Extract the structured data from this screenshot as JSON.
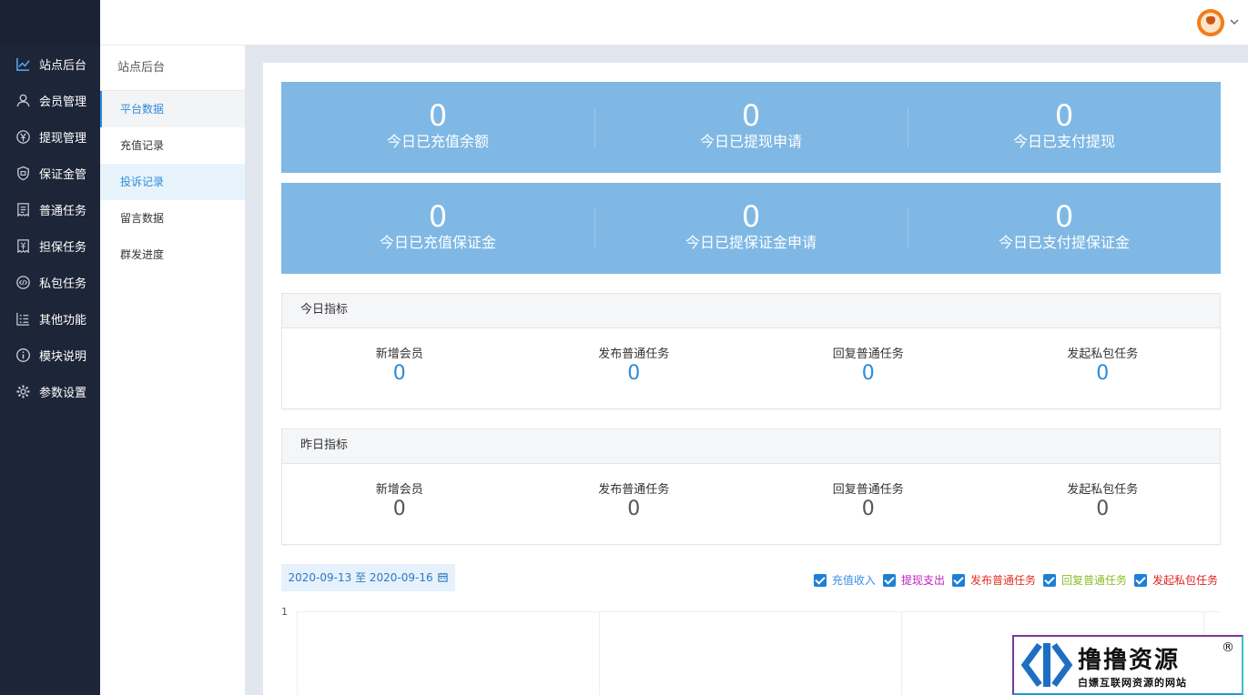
{
  "sidebar": {
    "items": [
      {
        "label": "站点后台",
        "icon": "chart-line-icon"
      },
      {
        "label": "会员管理",
        "icon": "user-icon"
      },
      {
        "label": "提现管理",
        "icon": "yen-icon"
      },
      {
        "label": "保证金管",
        "icon": "shield-icon"
      },
      {
        "label": "普通任务",
        "icon": "receipt-icon"
      },
      {
        "label": "担保任务",
        "icon": "guarantee-icon"
      },
      {
        "label": "私包任务",
        "icon": "code-icon"
      },
      {
        "label": "其他功能",
        "icon": "list-icon"
      },
      {
        "label": "模块说明",
        "icon": "info-icon"
      },
      {
        "label": "参数设置",
        "icon": "gear-icon"
      }
    ]
  },
  "submenu": {
    "title": "站点后台",
    "items": [
      {
        "label": "平台数据"
      },
      {
        "label": "充值记录"
      },
      {
        "label": "投诉记录"
      },
      {
        "label": "留言数据"
      },
      {
        "label": "群发进度"
      }
    ]
  },
  "stats": {
    "row1": [
      {
        "value": "0",
        "label": "今日已充值余额"
      },
      {
        "value": "0",
        "label": "今日已提现申请"
      },
      {
        "value": "0",
        "label": "今日已支付提现"
      }
    ],
    "row2": [
      {
        "value": "0",
        "label": "今日已充值保证金"
      },
      {
        "value": "0",
        "label": "今日已提保证金申请"
      },
      {
        "value": "0",
        "label": "今日已支付提保证金"
      }
    ]
  },
  "today": {
    "title": "今日指标",
    "items": [
      {
        "label": "新增会员",
        "value": "0"
      },
      {
        "label": "发布普通任务",
        "value": "0"
      },
      {
        "label": "回复普通任务",
        "value": "0"
      },
      {
        "label": "发起私包任务",
        "value": "0"
      }
    ]
  },
  "yesterday": {
    "title": "昨日指标",
    "items": [
      {
        "label": "新增会员",
        "value": "0"
      },
      {
        "label": "发布普通任务",
        "value": "0"
      },
      {
        "label": "回复普通任务",
        "value": "0"
      },
      {
        "label": "发起私包任务",
        "value": "0"
      }
    ]
  },
  "date_range": {
    "label": "2020-09-13 至 2020-09-16"
  },
  "legend": [
    {
      "label": "充值收入",
      "color": "#3a8ee6"
    },
    {
      "label": "提现支出",
      "color": "#c020c0"
    },
    {
      "label": "发布普通任务",
      "color": "#e03020"
    },
    {
      "label": "回复普通任务",
      "color": "#8bbf2a"
    },
    {
      "label": "发起私包任务",
      "color": "#e02020"
    }
  ],
  "chart": {
    "y_tick": "1"
  },
  "watermark": {
    "title": "撸撸资源",
    "subtitle": "白嫖互联网资源的网站",
    "reg": "®"
  },
  "colors": {
    "sidebar_bg": "#1d2538",
    "stat_bg": "#7fb8e4",
    "accent": "#2d8cd9"
  }
}
